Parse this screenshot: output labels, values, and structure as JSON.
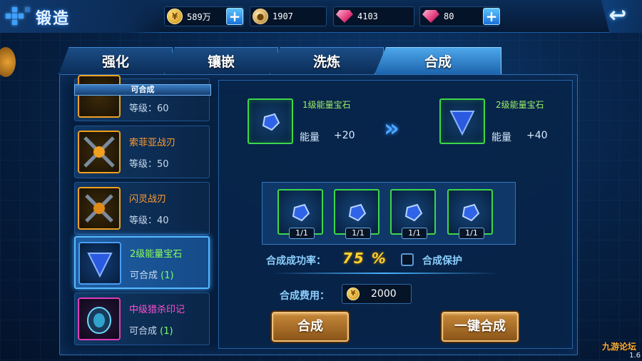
{
  "header": {
    "title": "锻造",
    "resources": [
      {
        "icon": "gold-coin-icon",
        "value": "589万"
      },
      {
        "icon": "bronze-coin-icon",
        "value": "1907"
      },
      {
        "icon": "pink-gem-icon",
        "value": "4103"
      },
      {
        "icon": "diamond-icon",
        "value": "80"
      }
    ],
    "back_icon": "back-arrow-icon"
  },
  "tabs": [
    {
      "label": "强化",
      "active": false
    },
    {
      "label": "镶嵌",
      "active": false
    },
    {
      "label": "洗炼",
      "active": false
    },
    {
      "label": "合成",
      "active": true
    }
  ],
  "list": {
    "header": "可合成",
    "items": [
      {
        "name": "",
        "sub": "等级：60",
        "frame": "orange"
      },
      {
        "name": "索菲亚战刃",
        "sub": "等级：50",
        "frame": "orange"
      },
      {
        "name": "闪灵战刃",
        "sub": "等级：40",
        "frame": "orange"
      },
      {
        "name": "2级能量宝石",
        "sub_label": "可合成",
        "sub_count": "(1)",
        "frame": "blue",
        "selected": true
      },
      {
        "name": "中级猎杀印记",
        "sub_label": "可合成",
        "sub_count": "(1)",
        "frame": "purple"
      }
    ]
  },
  "synthesis": {
    "source": {
      "name": "1级能量宝石",
      "attr_label": "能量",
      "attr_value": "+20"
    },
    "target": {
      "name": "2级能量宝石",
      "attr_label": "能量",
      "attr_value": "+40"
    },
    "materials": [
      {
        "qty": "1/1"
      },
      {
        "qty": "1/1"
      },
      {
        "qty": "1/1"
      },
      {
        "qty": "1/1"
      }
    ],
    "rate_label": "合成成功率：",
    "rate_value": "75 %",
    "protect_label": "合成保护",
    "cost_label": "合成费用：",
    "cost_value": "2000",
    "btn_synth": "合成",
    "btn_synth_all": "一键合成"
  },
  "footer": {
    "watermark": "九游论坛",
    "version": "1.6"
  }
}
